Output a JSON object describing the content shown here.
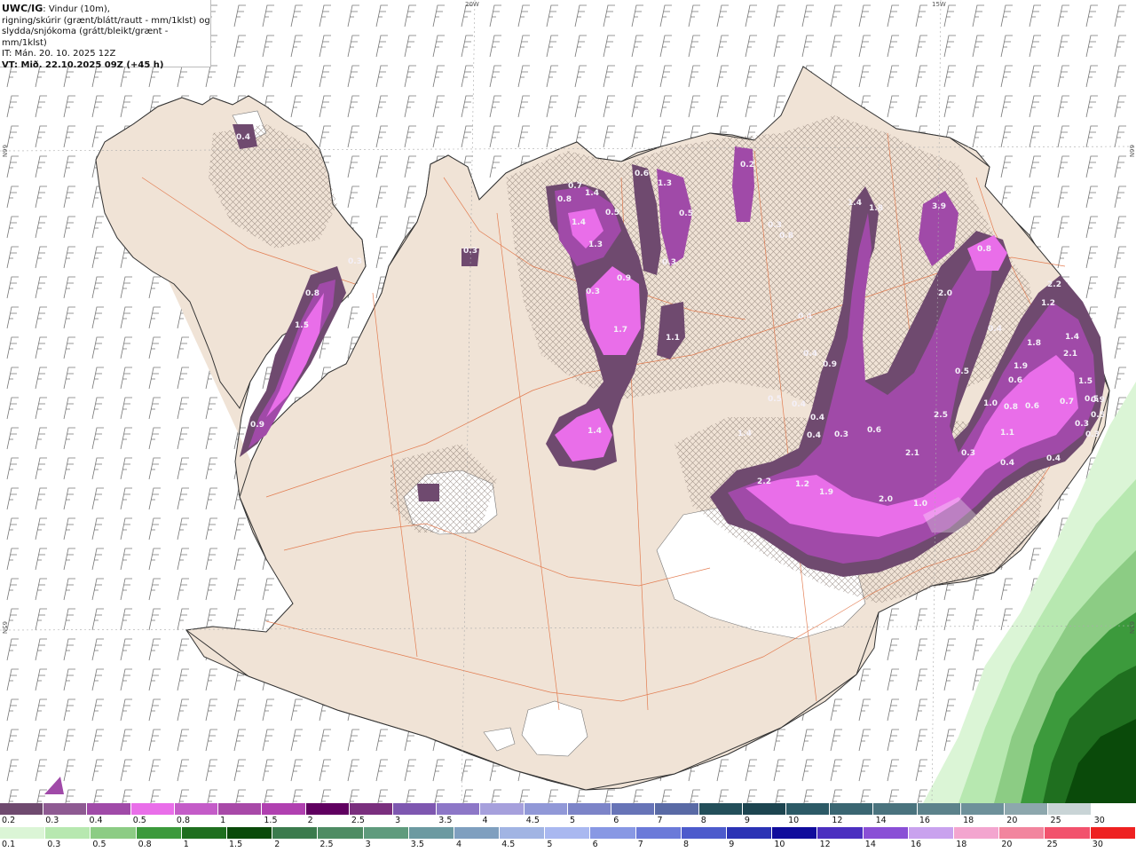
{
  "info_box": {
    "title": "UWC/IG",
    "line1_rest": ": Vindur (10m),",
    "line2": "rigning/skúrir (grænt/blátt/rautt - mm/1klst) og",
    "line3": "slydda/snjókoma (grátt/bleikt/grænt - mm/1klst)",
    "line4": "IT: Mán. 20. 10. 2025 12Z",
    "line5": "VT: Mið. 22.10.2025 09Z (+45 h)"
  },
  "graticule": {
    "top_left": "20W",
    "top_right": "15W",
    "left_top": "66N",
    "left_bottom": "65N",
    "right_top": "66N",
    "right_bottom": "65N"
  },
  "precip_values": [
    "0.4",
    "0.3",
    "0.8",
    "1.5",
    "0.9",
    "0.3",
    "0.7",
    "1.4",
    "0.8",
    "1.4",
    "0.5",
    "1.3",
    "0.3",
    "0.9",
    "1.7",
    "1.4",
    "0.6",
    "1.3",
    "0.5",
    "0.3",
    "1.1",
    "0.2",
    "0.3",
    "0.8",
    "1.4",
    "1.8",
    "3.9",
    "0.8",
    "2.0",
    "0.4",
    "0.4",
    "0.9",
    "0.5",
    "0.4",
    "0.4",
    "0.4",
    "0.3",
    "0.6",
    "1.4",
    "2.2",
    "1.2",
    "1.9",
    "2.0",
    "1.0",
    "2.1",
    "0.3",
    "0.4",
    "0.4",
    "2.5",
    "2.2",
    "1.2",
    "1.8",
    "1.4",
    "2.1",
    "1.9",
    "0.6",
    "1.5",
    "1.0",
    "0.8",
    "0.6",
    "0.5",
    "0.9",
    "0.7",
    "0.5",
    "0.3",
    "0.3",
    "0.4",
    "0.5",
    "1.1"
  ],
  "legend_snow": {
    "labels": [
      "0.2",
      "0.3",
      "0.4",
      "0.5",
      "0.8",
      "1",
      "1.5",
      "2",
      "2.5",
      "3",
      "3.5",
      "4",
      "4.5",
      "5",
      "6",
      "7",
      "8",
      "9",
      "10",
      "12",
      "14",
      "16",
      "18",
      "20",
      "25",
      "30"
    ],
    "colors": [
      "#6f4a6f",
      "#8e5a92",
      "#a04aa8",
      "#e96ee9",
      "#c45cc8",
      "#a849a8",
      "#b040b0",
      "#600060",
      "#7a2f7e",
      "#7e57b0",
      "#8d77c7",
      "#a6a0dc",
      "#9198d7",
      "#7c84c8",
      "#6774b7",
      "#596aa5",
      "#234f5a",
      "#1d4550",
      "#2c5a66",
      "#3a6672",
      "#4a737e",
      "#5c828b",
      "#6e919a",
      "#8da7ad",
      "#c9d4d6"
    ]
  },
  "legend_rain": {
    "labels": [
      "0.1",
      "0.3",
      "0.5",
      "0.8",
      "1",
      "1.5",
      "2",
      "2.5",
      "3",
      "3.5",
      "4",
      "4.5",
      "5",
      "6",
      "7",
      "8",
      "9",
      "10",
      "12",
      "14",
      "16",
      "18",
      "20",
      "25",
      "30"
    ],
    "colors": [
      "#dbf5d6",
      "#b7e8b0",
      "#8ccc84",
      "#3c9a3c",
      "#1f6f1f",
      "#0a4a0a",
      "#3b7b4d",
      "#4e8c63",
      "#5f9b7d",
      "#6c9aa1",
      "#7f9fbf",
      "#a1b4e3",
      "#a9b8f0",
      "#8898e4",
      "#6b7ad9",
      "#4d5bcc",
      "#2b33b5",
      "#100c9c",
      "#4b2fc0",
      "#8a4fd6",
      "#c9a2ee",
      "#f3a5cf",
      "#f2859e",
      "#f2526d",
      "#ee2121"
    ]
  }
}
